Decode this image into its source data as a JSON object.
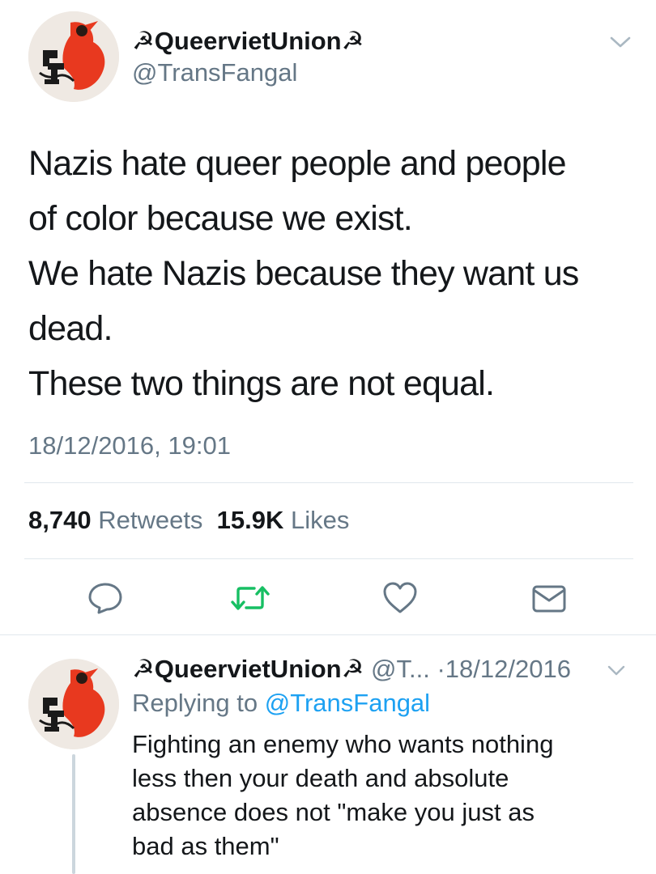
{
  "main_tweet": {
    "display_name": "☭QueervietUnion☭",
    "handle": "@TransFangal",
    "lines": [
      "Nazis hate queer people and people",
      "of color because we exist.",
      "We hate Nazis because they want us",
      "dead.",
      "These two things are not equal."
    ],
    "timestamp": "18/12/2016, 19:01",
    "retweet_count": "8,740",
    "retweet_label": "Retweets",
    "like_count": "15.9K",
    "like_label": "Likes"
  },
  "actions": {
    "reply_icon": "reply-icon",
    "retweet_icon": "retweet-icon",
    "like_icon": "heart-icon",
    "dm_icon": "envelope-icon",
    "retweet_color": "#17bf63",
    "icon_color": "#657786"
  },
  "reply_tweet": {
    "display_name": "☭QueervietUnion☭",
    "handle": "@T...",
    "separator": "·",
    "date": "18/12/2016",
    "replying_prefix": "Replying to",
    "replying_handle": "@TransFangal",
    "lines": [
      "Fighting an enemy who wants nothing",
      "less then your death and absolute",
      "absence does not \"make you just as",
      "bad as them\""
    ]
  },
  "colors": {
    "link": "#1da1f2",
    "secondary_text": "#657786",
    "divider": "#e1e8ed"
  }
}
